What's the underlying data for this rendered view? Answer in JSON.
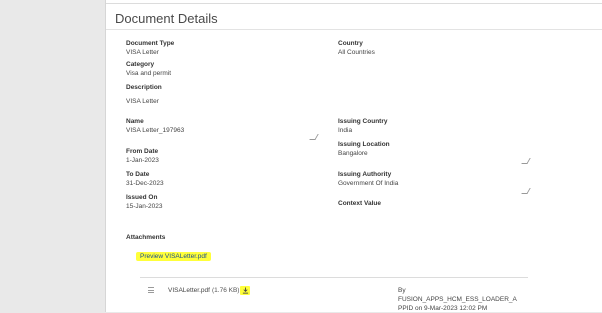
{
  "page": {
    "title": "Document Details"
  },
  "fields": {
    "document_type": {
      "label": "Document Type",
      "value": "VISA Letter"
    },
    "category": {
      "label": "Category",
      "value": "Visa and permit"
    },
    "description": {
      "label": "Description",
      "value": "VISA Letter"
    },
    "name": {
      "label": "Name",
      "value": "VISA Letter_197963"
    },
    "from_date": {
      "label": "From Date",
      "value": "1-Jan-2023"
    },
    "to_date": {
      "label": "To Date",
      "value": "31-Dec-2023"
    },
    "issued_on": {
      "label": "Issued On",
      "value": "15-Jan-2023"
    },
    "country": {
      "label": "Country",
      "value": "All Countries"
    },
    "issuing_country": {
      "label": "Issuing Country",
      "value": "India"
    },
    "issuing_location": {
      "label": "Issuing Location",
      "value": "Bangalore"
    },
    "issuing_authority": {
      "label": "Issuing Authority",
      "value": "Government Of India"
    },
    "context_value": {
      "label": "Context Value",
      "value": ""
    }
  },
  "attachments": {
    "title": "Attachments",
    "preview_link": "Preview VISALetter.pdf",
    "file_name": "VISALetter.pdf",
    "file_size": "(1.76 KB)",
    "uploaded_by": "By FUSION_APPS_HCM_ESS_LOADER_A PPID on 9-Mar-2023 12:02 PM"
  },
  "colors": {
    "highlight": "#ffff3a",
    "link": "#1a4f8f"
  },
  "icons": {
    "drag": "drag-handle-icon",
    "download": "download-icon",
    "resize": "resize-handle-icon"
  }
}
